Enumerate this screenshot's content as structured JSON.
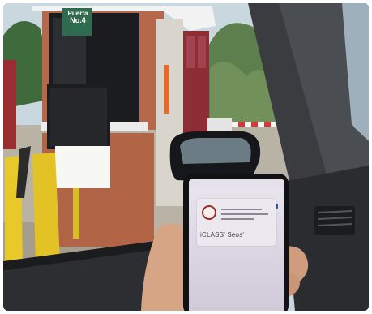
{
  "booth_sign": {
    "line1": "Puerta",
    "line2": "No.4"
  },
  "phone": {
    "card_brand": "iCLASS' Seos'"
  },
  "colors": {
    "sky": "#c9d8df",
    "brick": "#b5684a",
    "trim": "#f2f2f2",
    "sign_green": "#2f6b4e",
    "bollard_yellow": "#e8c92a",
    "reader_black": "#1c1d20",
    "dashboard": "#2a2c2f"
  }
}
